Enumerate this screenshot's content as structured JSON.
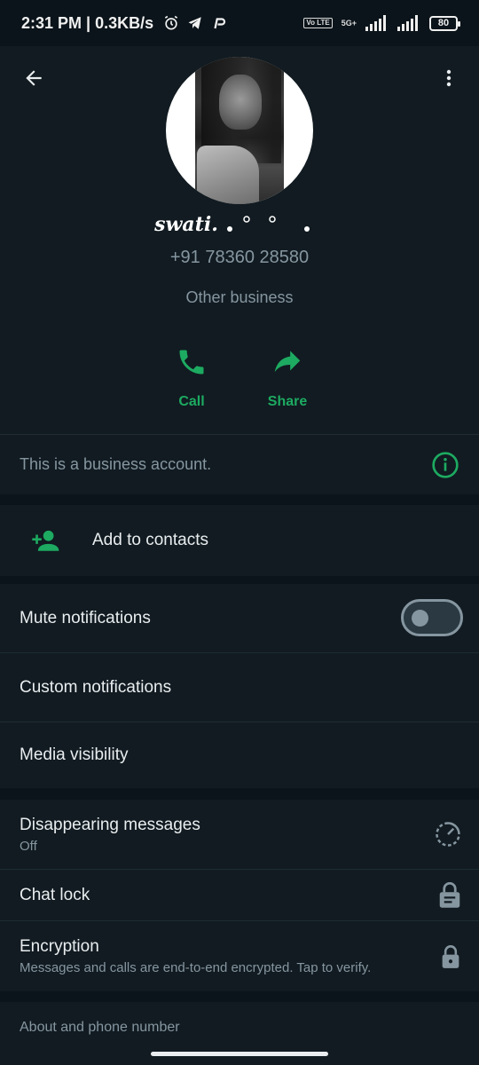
{
  "status_bar": {
    "time_speed": "2:31 PM | 0.3KB/s",
    "volte": "Vo LTE",
    "network": "5G+",
    "battery": "80"
  },
  "header": {
    "back_icon": "arrow-left-icon",
    "menu_icon": "more-vertical-icon"
  },
  "profile": {
    "name": "swati.",
    "phone": "+91 78360 28580",
    "category": "Other business"
  },
  "actions": {
    "call_label": "Call",
    "share_label": "Share"
  },
  "business_banner": {
    "text": "This is a business account.",
    "icon": "info-icon"
  },
  "add_contacts": {
    "label": "Add to contacts",
    "icon": "person-add-icon"
  },
  "settings": {
    "mute_label": "Mute notifications",
    "mute_enabled": false,
    "custom_label": "Custom notifications",
    "media_label": "Media visibility"
  },
  "privacy": {
    "disappearing_label": "Disappearing messages",
    "disappearing_value": "Off",
    "chat_lock_label": "Chat lock",
    "encryption_label": "Encryption",
    "encryption_sub": "Messages and calls are end-to-end encrypted. Tap to verify."
  },
  "about": {
    "title": "About and phone number"
  },
  "colors": {
    "background": "#0b141a",
    "surface": "#111b21",
    "accent": "#1daa61",
    "text_secondary": "#8696a0"
  }
}
